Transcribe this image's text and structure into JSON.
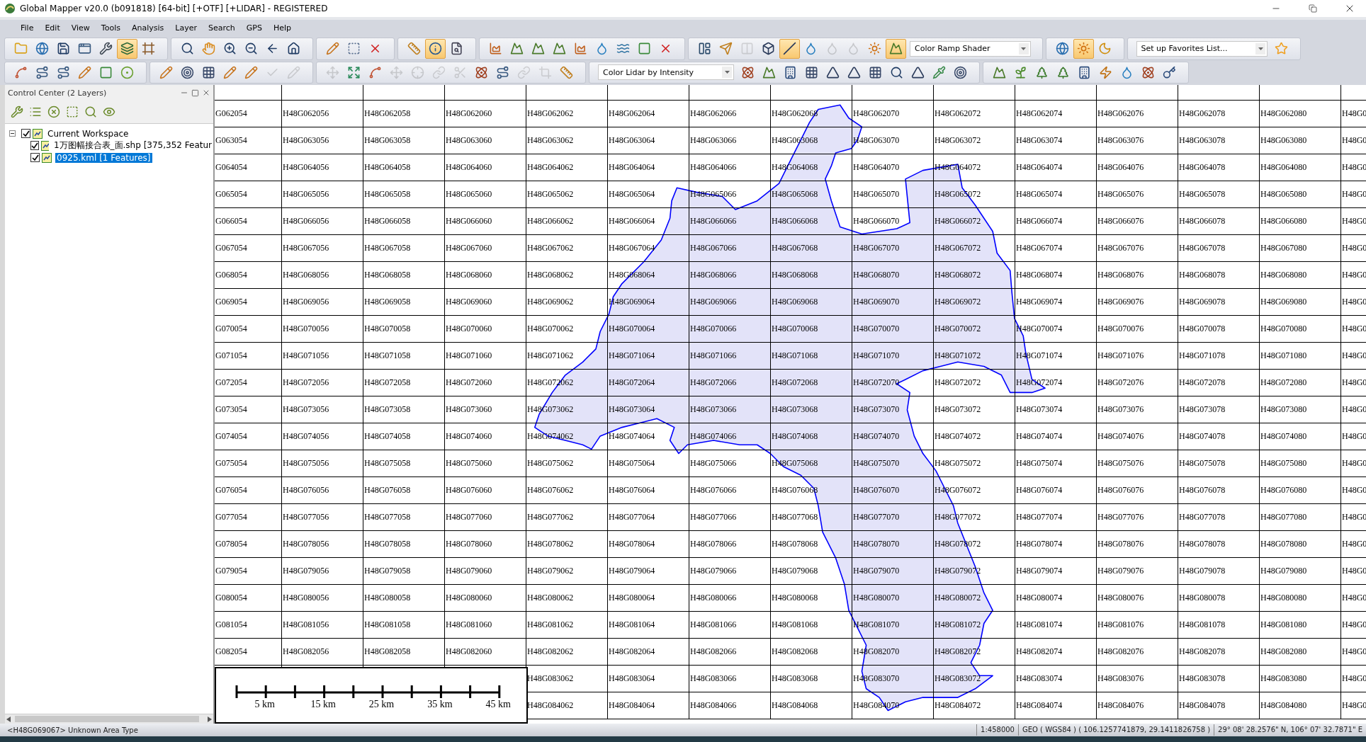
{
  "window": {
    "title": "Global Mapper v20.0 (b091818) [64-bit] [+OTF] [+LIDAR] - REGISTERED"
  },
  "menu": [
    "File",
    "Edit",
    "View",
    "Tools",
    "Analysis",
    "Layer",
    "Search",
    "GPS",
    "Help"
  ],
  "toolbars": [
    {
      "groups": [
        {
          "items": [
            {
              "kind": "folder",
              "pressed": false,
              "disabled": false
            },
            {
              "kind": "globe",
              "pressed": false,
              "disabled": false
            },
            {
              "kind": "save",
              "pressed": false,
              "disabled": false
            },
            {
              "kind": "window",
              "pressed": false,
              "disabled": false
            },
            {
              "kind": "wrench",
              "pressed": false,
              "disabled": false
            },
            {
              "kind": "layers",
              "pressed": true,
              "disabled": false
            },
            {
              "kind": "frame",
              "pressed": false,
              "disabled": false
            }
          ]
        },
        {
          "items": [
            {
              "kind": "search",
              "pressed": false,
              "disabled": false
            },
            {
              "kind": "hand",
              "pressed": false,
              "disabled": false
            },
            {
              "kind": "zoom-in",
              "pressed": false,
              "disabled": false
            },
            {
              "kind": "zoom-out",
              "pressed": false,
              "disabled": false
            },
            {
              "kind": "back",
              "pressed": false,
              "disabled": false
            },
            {
              "kind": "home",
              "pressed": false,
              "disabled": false
            }
          ]
        },
        {
          "items": [
            {
              "kind": "pencil",
              "pressed": false,
              "disabled": false
            },
            {
              "kind": "select",
              "pressed": false,
              "disabled": false
            },
            {
              "kind": "delete",
              "pressed": false,
              "disabled": false
            }
          ]
        },
        {
          "items": [
            {
              "kind": "ruler",
              "pressed": false,
              "disabled": false
            },
            {
              "kind": "info",
              "pressed": true,
              "disabled": false
            },
            {
              "kind": "file-search",
              "pressed": false,
              "disabled": false
            }
          ]
        },
        {
          "items": [
            {
              "kind": "chart",
              "pressed": false,
              "disabled": false
            },
            {
              "kind": "mountain",
              "pressed": false,
              "disabled": false
            },
            {
              "kind": "mountain",
              "pressed": false,
              "disabled": false
            },
            {
              "kind": "mountain",
              "pressed": false,
              "disabled": false
            },
            {
              "kind": "chart",
              "pressed": false,
              "disabled": false
            },
            {
              "kind": "droplet",
              "pressed": false,
              "disabled": false
            },
            {
              "kind": "waves",
              "pressed": false,
              "disabled": false
            },
            {
              "kind": "square",
              "pressed": false,
              "disabled": false
            },
            {
              "kind": "delete",
              "pressed": false,
              "disabled": false
            }
          ]
        },
        {
          "items": [
            {
              "kind": "layout",
              "pressed": false,
              "disabled": false
            },
            {
              "kind": "send",
              "pressed": false,
              "disabled": false
            },
            {
              "kind": "split",
              "pressed": false,
              "disabled": true
            },
            {
              "kind": "box",
              "pressed": false,
              "disabled": false
            },
            {
              "kind": "slash",
              "pressed": true,
              "disabled": false
            },
            {
              "kind": "droplet",
              "pressed": false,
              "disabled": false
            },
            {
              "kind": "droplet",
              "pressed": false,
              "disabled": true
            },
            {
              "kind": "droplet",
              "pressed": false,
              "disabled": true
            },
            {
              "kind": "sun",
              "pressed": false,
              "disabled": false
            },
            {
              "kind": "mountain",
              "pressed": true,
              "disabled": false
            },
            {
              "kind": "dropdown",
              "value": "Color Ramp Shader"
            }
          ]
        },
        {
          "items": [
            {
              "kind": "globe",
              "pressed": false,
              "disabled": false
            },
            {
              "kind": "sun",
              "pressed": true,
              "disabled": false
            },
            {
              "kind": "moon",
              "pressed": false,
              "disabled": false
            }
          ]
        },
        {
          "items": [
            {
              "kind": "dropdown",
              "value": "Set up Favorites List..."
            },
            {
              "kind": "star",
              "pressed": false,
              "disabled": false
            }
          ]
        }
      ]
    },
    {
      "groups": [
        {
          "items": [
            {
              "kind": "spline",
              "pressed": false,
              "disabled": false
            },
            {
              "kind": "route",
              "pressed": false,
              "disabled": false
            },
            {
              "kind": "route",
              "pressed": false,
              "disabled": false
            },
            {
              "kind": "pencil",
              "pressed": false,
              "disabled": false
            },
            {
              "kind": "square",
              "pressed": false,
              "disabled": false
            },
            {
              "kind": "circle-dot",
              "pressed": false,
              "disabled": false
            }
          ]
        },
        {
          "items": [
            {
              "kind": "pencil",
              "pressed": false,
              "disabled": false
            },
            {
              "kind": "target",
              "pressed": false,
              "disabled": false
            },
            {
              "kind": "grid",
              "pressed": false,
              "disabled": false
            },
            {
              "kind": "pencil",
              "pressed": false,
              "disabled": false
            },
            {
              "kind": "pencil",
              "pressed": false,
              "disabled": false
            },
            {
              "kind": "check",
              "pressed": false,
              "disabled": true
            },
            {
              "kind": "pencil",
              "pressed": false,
              "disabled": true
            }
          ]
        },
        {
          "items": [
            {
              "kind": "move",
              "pressed": false,
              "disabled": true
            },
            {
              "kind": "expand",
              "pressed": false,
              "disabled": false
            },
            {
              "kind": "spline",
              "pressed": false,
              "disabled": false
            },
            {
              "kind": "move",
              "pressed": false,
              "disabled": true
            },
            {
              "kind": "crosshair",
              "pressed": false,
              "disabled": true
            },
            {
              "kind": "link",
              "pressed": false,
              "disabled": true
            },
            {
              "kind": "scissors",
              "pressed": false,
              "disabled": true
            },
            {
              "kind": "atom",
              "pressed": false,
              "disabled": false
            },
            {
              "kind": "route",
              "pressed": false,
              "disabled": false
            },
            {
              "kind": "link",
              "pressed": false,
              "disabled": true
            },
            {
              "kind": "crop",
              "pressed": false,
              "disabled": true
            },
            {
              "kind": "ruler",
              "pressed": false,
              "disabled": false
            }
          ]
        },
        {
          "items": [
            {
              "kind": "dropdown",
              "value": "Color Lidar by Intensity"
            },
            {
              "kind": "atom",
              "pressed": false,
              "disabled": false
            },
            {
              "kind": "mountain",
              "pressed": false,
              "disabled": false
            },
            {
              "kind": "building",
              "pressed": false,
              "disabled": false
            },
            {
              "kind": "grid",
              "pressed": false,
              "disabled": false
            },
            {
              "kind": "triangle",
              "pressed": false,
              "disabled": false
            },
            {
              "kind": "triangle",
              "pressed": false,
              "disabled": false
            },
            {
              "kind": "grid",
              "pressed": false,
              "disabled": false
            },
            {
              "kind": "search",
              "pressed": false,
              "disabled": false
            },
            {
              "kind": "triangle",
              "pressed": false,
              "disabled": false
            },
            {
              "kind": "pipette",
              "pressed": false,
              "disabled": false
            },
            {
              "kind": "target",
              "pressed": false,
              "disabled": false
            }
          ]
        },
        {
          "items": [
            {
              "kind": "mountain",
              "pressed": false,
              "disabled": false
            },
            {
              "kind": "sprout",
              "pressed": false,
              "disabled": false
            },
            {
              "kind": "tree",
              "pressed": false,
              "disabled": false
            },
            {
              "kind": "tree",
              "pressed": false,
              "disabled": false
            },
            {
              "kind": "building",
              "pressed": false,
              "disabled": false
            },
            {
              "kind": "zap",
              "pressed": false,
              "disabled": false
            },
            {
              "kind": "droplet",
              "pressed": false,
              "disabled": false
            },
            {
              "kind": "atom",
              "pressed": false,
              "disabled": false
            },
            {
              "kind": "key",
              "pressed": false,
              "disabled": false
            }
          ]
        }
      ]
    }
  ],
  "control_center": {
    "title": "Control Center (2 Layers)",
    "tree": [
      {
        "label": "Current Workspace",
        "checked": true,
        "expanded": true,
        "selected": false,
        "children": [
          {
            "label": "1万图幅接合表_面.shp [375,352 Featur",
            "checked": true,
            "selected": false
          },
          {
            "label": "0925.kml [1 Features]",
            "checked": true,
            "selected": true
          }
        ]
      }
    ]
  },
  "map": {
    "rows": [
      {
        "cells": [
          "G062054",
          "H48G062056",
          "H48G062058",
          "H48G062060",
          "H48G062062",
          "H48G062064",
          "H48G062066",
          "H48G062068",
          "H48G062070",
          "H48G062072",
          "H48G062074",
          "H48G062076",
          "H48G062078",
          "H48G062080",
          "H48G0"
        ]
      },
      {
        "cells": [
          "G063054",
          "H48G063056",
          "H48G063058",
          "H48G063060",
          "H48G063062",
          "H48G063064",
          "H48G063066",
          "H48G063068",
          "H48G063070",
          "H48G063072",
          "H48G063074",
          "H48G063076",
          "H48G063078",
          "H48G063080",
          "H48G0"
        ]
      },
      {
        "cells": [
          "G064054",
          "H48G064056",
          "H48G064058",
          "H48G064060",
          "H48G064062",
          "H48G064064",
          "H48G064066",
          "H48G064068",
          "H48G064070",
          "H48G064072",
          "H48G064074",
          "H48G064076",
          "H48G064078",
          "H48G064080",
          "H48G0"
        ]
      },
      {
        "cells": [
          "G065054",
          "H48G065056",
          "H48G065058",
          "H48G065060",
          "H48G065062",
          "H48G065064",
          "H48G065066",
          "H48G065068",
          "H48G065070",
          "H48G065072",
          "H48G065074",
          "H48G065076",
          "H48G065078",
          "H48G065080",
          "H48G0"
        ]
      },
      {
        "cells": [
          "G066054",
          "H48G066056",
          "H48G066058",
          "H48G066060",
          "H48G066062",
          "H48G066064",
          "H48G066066",
          "H48G066068",
          "H48G066070",
          "H48G066072",
          "H48G066074",
          "H48G066076",
          "H48G066078",
          "H48G066080",
          "H48G0"
        ]
      },
      {
        "cells": [
          "G067054",
          "H48G067056",
          "H48G067058",
          "H48G067060",
          "H48G067062",
          "H48G067064",
          "H48G067066",
          "H48G067068",
          "H48G067070",
          "H48G067072",
          "H48G067074",
          "H48G067076",
          "H48G067078",
          "H48G067080",
          "H48G0"
        ]
      },
      {
        "cells": [
          "G068054",
          "H48G068056",
          "H48G068058",
          "H48G068060",
          "H48G068062",
          "H48G068064",
          "H48G068066",
          "H48G068068",
          "H48G068070",
          "H48G068072",
          "H48G068074",
          "H48G068076",
          "H48G068078",
          "H48G068080",
          "H48G0"
        ]
      },
      {
        "cells": [
          "G069054",
          "H48G069056",
          "H48G069058",
          "H48G069060",
          "H48G069062",
          "H48G069064",
          "H48G069066",
          "H48G069068",
          "H48G069070",
          "H48G069072",
          "H48G069074",
          "H48G069076",
          "H48G069078",
          "H48G069080",
          "H48G0"
        ]
      },
      {
        "cells": [
          "G070054",
          "H48G070056",
          "H48G070058",
          "H48G070060",
          "H48G070062",
          "H48G070064",
          "H48G070066",
          "H48G070068",
          "H48G070070",
          "H48G070072",
          "H48G070074",
          "H48G070076",
          "H48G070078",
          "H48G070080",
          "H48G0"
        ]
      },
      {
        "cells": [
          "G071054",
          "H48G071056",
          "H48G071058",
          "H48G071060",
          "H48G071062",
          "H48G071064",
          "H48G071066",
          "H48G071068",
          "H48G071070",
          "H48G071072",
          "H48G071074",
          "H48G071076",
          "H48G071078",
          "H48G071080",
          "H48G0"
        ]
      },
      {
        "cells": [
          "G072054",
          "H48G072056",
          "H48G072058",
          "H48G072060",
          "H48G072062",
          "H48G072064",
          "H48G072066",
          "H48G072068",
          "H48G072070",
          "H48G072072",
          "H48G072074",
          "H48G072076",
          "H48G072078",
          "H48G072080",
          "H48G0"
        ]
      },
      {
        "cells": [
          "G073054",
          "H48G073056",
          "H48G073058",
          "H48G073060",
          "H48G073062",
          "H48G073064",
          "H48G073066",
          "H48G073068",
          "H48G073070",
          "H48G073072",
          "H48G073074",
          "H48G073076",
          "H48G073078",
          "H48G073080",
          "H48G0"
        ]
      },
      {
        "cells": [
          "G074054",
          "H48G074056",
          "H48G074058",
          "H48G074060",
          "H48G074062",
          "H48G074064",
          "H48G074066",
          "H48G074068",
          "H48G074070",
          "H48G074072",
          "H48G074074",
          "H48G074076",
          "H48G074078",
          "H48G074080",
          "H48G0"
        ]
      },
      {
        "cells": [
          "G075054",
          "H48G075056",
          "H48G075058",
          "H48G075060",
          "H48G075062",
          "H48G075064",
          "H48G075066",
          "H48G075068",
          "H48G075070",
          "H48G075072",
          "H48G075074",
          "H48G075076",
          "H48G075078",
          "H48G075080",
          "H48G0"
        ]
      },
      {
        "cells": [
          "G076054",
          "H48G076056",
          "H48G076058",
          "H48G076060",
          "H48G076062",
          "H48G076064",
          "H48G076066",
          "H48G076068",
          "H48G076070",
          "H48G076072",
          "H48G076074",
          "H48G076076",
          "H48G076078",
          "H48G076080",
          "H48G0"
        ]
      },
      {
        "cells": [
          "G077054",
          "H48G077056",
          "H48G077058",
          "H48G077060",
          "H48G077062",
          "H48G077064",
          "H48G077066",
          "H48G077068",
          "H48G077070",
          "H48G077072",
          "H48G077074",
          "H48G077076",
          "H48G077078",
          "H48G077080",
          "H48G0"
        ]
      },
      {
        "cells": [
          "G078054",
          "H48G078056",
          "H48G078058",
          "H48G078060",
          "H48G078062",
          "H48G078064",
          "H48G078066",
          "H48G078068",
          "H48G078070",
          "H48G078072",
          "H48G078074",
          "H48G078076",
          "H48G078078",
          "H48G078080",
          "H48G0"
        ]
      },
      {
        "cells": [
          "G079054",
          "H48G079056",
          "H48G079058",
          "H48G079060",
          "H48G079062",
          "H48G079064",
          "H48G079066",
          "H48G079068",
          "H48G079070",
          "H48G079072",
          "H48G079074",
          "H48G079076",
          "H48G079078",
          "H48G079080",
          "H48G0"
        ]
      },
      {
        "cells": [
          "G080054",
          "H48G080056",
          "H48G080058",
          "H48G080060",
          "H48G080062",
          "H48G080064",
          "H48G080066",
          "H48G080068",
          "H48G080070",
          "H48G080072",
          "H48G080074",
          "H48G080076",
          "H48G080078",
          "H48G080080",
          "H48G0"
        ]
      },
      {
        "cells": [
          "G081054",
          "H48G081056",
          "H48G081058",
          "H48G081060",
          "H48G081062",
          "H48G081064",
          "H48G081066",
          "H48G081068",
          "H48G081070",
          "H48G081072",
          "H48G081074",
          "H48G081076",
          "H48G081078",
          "H48G081080",
          "H48G0"
        ]
      },
      {
        "cells": [
          "G082054",
          "H48G082056",
          "H48G082058",
          "H48G082060",
          "H48G082062",
          "H48G082064",
          "H48G082066",
          "H48G082068",
          "H48G082070",
          "H48G082072",
          "H48G082074",
          "H48G082076",
          "H48G082078",
          "H48G082080",
          "H48G0"
        ]
      },
      {
        "cells": [
          null,
          null,
          null,
          null,
          "H48G083062",
          "H48G083064",
          "H48G083066",
          "H48G083068",
          "H48G083070",
          "H48G083072",
          "H48G083074",
          "H48G083076",
          "H48G083078",
          "H48G083080",
          "H48G0"
        ]
      },
      {
        "cells": [
          null,
          null,
          null,
          null,
          "H48G084062",
          "H48G084064",
          "H48G084066",
          "H48G084068",
          "H48G084070",
          "H48G084072",
          "H48G084074",
          "H48G084076",
          "H48G084078",
          "H48G084080",
          "H48G0"
        ]
      }
    ],
    "scale_bar": {
      "labels": [
        "5 km",
        "15 km",
        "25 km",
        "35 km",
        "45 km"
      ]
    }
  },
  "status_bar": {
    "info": "<H48G069067> Unknown Area Type",
    "scale": "1:458000",
    "coordinates": "GEO ( WGS84 ) ( 106.1257741879, 29.1411826758 )",
    "position": "29° 08' 28.2576\" N, 106° 07' 32.7871\" E"
  }
}
